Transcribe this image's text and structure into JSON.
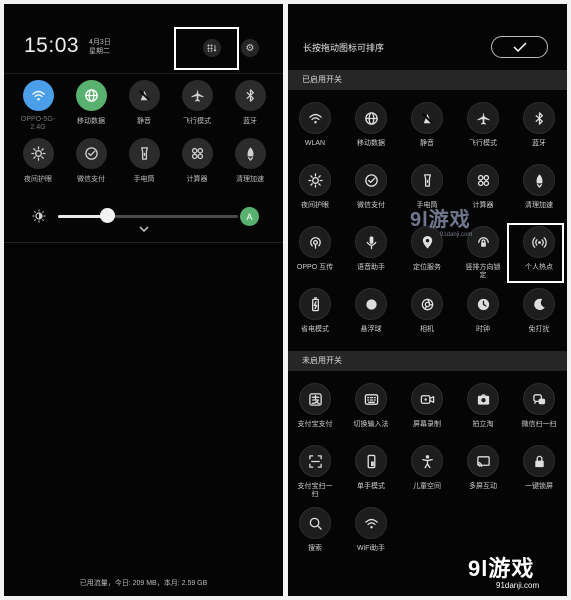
{
  "left": {
    "time": "15:03",
    "date_line1": "4月3日",
    "date_line2": "星期二",
    "tiles": [
      {
        "label": "OPPO-5G-",
        "label2": "2.4G",
        "icon": "wifi-icon",
        "state": "on"
      },
      {
        "label": "移动数据",
        "icon": "globe-icon",
        "state": "on"
      },
      {
        "label": "静音",
        "icon": "mute-icon",
        "state": "off"
      },
      {
        "label": "飞行模式",
        "icon": "airplane-icon",
        "state": "off"
      },
      {
        "label": "蓝牙",
        "icon": "bluetooth-icon",
        "state": "off"
      },
      {
        "label": "夜间护眼",
        "icon": "sun-icon",
        "state": "off"
      },
      {
        "label": "微信支付",
        "icon": "wechat-pay-icon",
        "state": "off"
      },
      {
        "label": "手电筒",
        "icon": "flashlight-icon",
        "state": "off"
      },
      {
        "label": "计算器",
        "icon": "calculator-icon",
        "state": "off"
      },
      {
        "label": "清理加速",
        "icon": "rocket-icon",
        "state": "off"
      }
    ],
    "brightness_level": 0.27,
    "auto_brightness_label": "A",
    "usage_text": "已用流量，今日: 209 MB，本月: 2.59 GB"
  },
  "right": {
    "title": "长按拖动图标可排序",
    "enabled_header": "已启用开关",
    "enabled_tiles": [
      {
        "label": "WLAN",
        "icon": "wifi-icon"
      },
      {
        "label": "移动数据",
        "icon": "globe-icon"
      },
      {
        "label": "静音",
        "icon": "mute-icon"
      },
      {
        "label": "飞行模式",
        "icon": "airplane-icon"
      },
      {
        "label": "蓝牙",
        "icon": "bluetooth-icon"
      },
      {
        "label": "夜间护眼",
        "icon": "sun-icon"
      },
      {
        "label": "微信支付",
        "icon": "wechat-pay-icon"
      },
      {
        "label": "手电筒",
        "icon": "flashlight-icon"
      },
      {
        "label": "计算器",
        "icon": "calculator-icon"
      },
      {
        "label": "清理加速",
        "icon": "rocket-icon"
      },
      {
        "label": "OPPO 互传",
        "icon": "share-icon"
      },
      {
        "label": "语音助手",
        "icon": "microphone-icon"
      },
      {
        "label": "定位服务",
        "icon": "location-icon"
      },
      {
        "label": "竖排方向锁",
        "label2": "定",
        "icon": "rotation-lock-icon"
      },
      {
        "label": "个人热点",
        "icon": "hotspot-icon"
      },
      {
        "label": "省电模式",
        "icon": "battery-icon"
      },
      {
        "label": "悬浮球",
        "icon": "floating-ball-icon"
      },
      {
        "label": "相机",
        "icon": "camera-icon"
      },
      {
        "label": "时钟",
        "icon": "clock-icon"
      },
      {
        "label": "免打扰",
        "icon": "moon-icon"
      }
    ],
    "disabled_header": "未启用开关",
    "disabled_tiles": [
      {
        "label": "支付宝支付",
        "icon": "alipay-icon"
      },
      {
        "label": "切换输入法",
        "icon": "keyboard-icon"
      },
      {
        "label": "屏幕录制",
        "icon": "screen-record-icon"
      },
      {
        "label": "拍立淘",
        "icon": "photo-search-icon"
      },
      {
        "label": "微信扫一扫",
        "icon": "wechat-scan-icon"
      },
      {
        "label": "支付宝扫一",
        "label2": "扫",
        "icon": "alipay-scan-icon"
      },
      {
        "label": "单手模式",
        "icon": "one-hand-icon"
      },
      {
        "label": "儿童空间",
        "icon": "kids-icon"
      },
      {
        "label": "多屏互动",
        "icon": "cast-icon"
      },
      {
        "label": "一键锁屏",
        "icon": "lock-icon"
      },
      {
        "label": "搜索",
        "icon": "search-icon"
      },
      {
        "label": "WiFi助手",
        "icon": "wifi-assistant-icon"
      }
    ]
  },
  "watermark_mid": {
    "big": "9l游戏",
    "small": "91danji.com"
  },
  "watermark_br": {
    "big": "9l游戏",
    "small": "91danji.com"
  },
  "colors": {
    "background": "#050505",
    "active_blue": "#4b9fe8",
    "active_green": "#58b16f",
    "section": "#262626"
  }
}
